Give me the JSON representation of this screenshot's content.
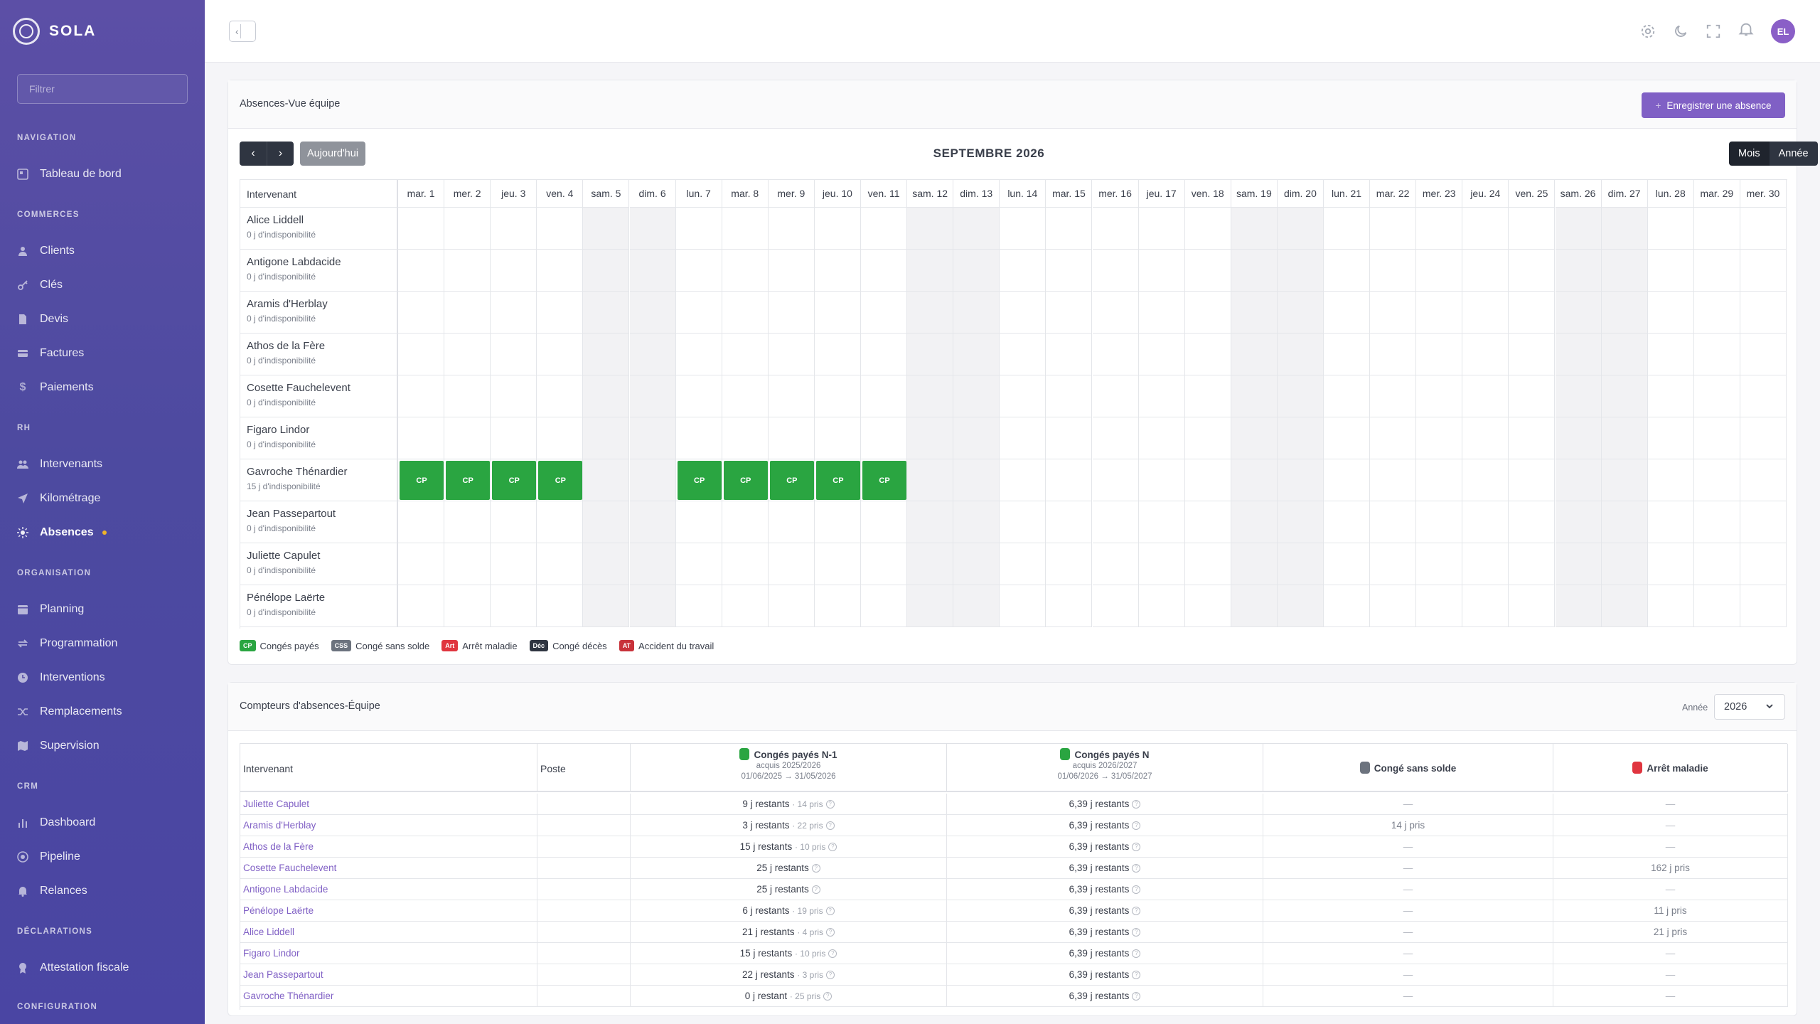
{
  "app": {
    "name": "SOLA"
  },
  "sidebar": {
    "filter_placeholder": "Filtrer",
    "sections": {
      "navigation": "NAVIGATION",
      "commerces": "COMMERCES",
      "rh": "RH",
      "organisation": "ORGANISATION",
      "crm": "CRM",
      "declarations": "DÉCLARATIONS",
      "configuration": "CONFIGURATION"
    },
    "items": {
      "tableau": "Tableau de bord",
      "clients": "Clients",
      "cles": "Clés",
      "devis": "Devis",
      "factures": "Factures",
      "paiements": "Paiements",
      "intervenants": "Intervenants",
      "kilometrage": "Kilométrage",
      "absences": "Absences",
      "planning": "Planning",
      "programmation": "Programmation",
      "interventions": "Interventions",
      "remplacements": "Remplacements",
      "supervision": "Supervision",
      "dashboard": "Dashboard",
      "pipeline": "Pipeline",
      "relances": "Relances",
      "attestation": "Attestation fiscale"
    }
  },
  "topbar": {
    "avatar_initials": "EL"
  },
  "absences": {
    "title": "Absences-Vue équipe",
    "register_label": "Enregistrer une absence",
    "today_label": "Aujourd'hui",
    "month_label": "SEPTEMBRE 2026",
    "view_mois": "Mois",
    "view_annee": "Année",
    "name_header": "Intervenant",
    "days": [
      "mar. 1",
      "mer. 2",
      "jeu. 3",
      "ven. 4",
      "sam. 5",
      "dim. 6",
      "lun. 7",
      "mar. 8",
      "mer. 9",
      "jeu. 10",
      "ven. 11",
      "sam. 12",
      "dim. 13",
      "lun. 14",
      "mar. 15",
      "mer. 16",
      "jeu. 17",
      "ven. 18",
      "sam. 19",
      "dim. 20",
      "lun. 21",
      "mar. 22",
      "mer. 23",
      "jeu. 24",
      "ven. 25",
      "sam. 26",
      "dim. 27",
      "lun. 28",
      "mar. 29",
      "mer. 30"
    ],
    "weekend_index": [
      4,
      5,
      11,
      12,
      18,
      19,
      25,
      26
    ],
    "rows": [
      {
        "name": "Alice Liddell",
        "sub": "0 j d'indisponibilité",
        "cp": []
      },
      {
        "name": "Antigone Labdacide",
        "sub": "0 j d'indisponibilité",
        "cp": []
      },
      {
        "name": "Aramis d'Herblay",
        "sub": "0 j d'indisponibilité",
        "cp": []
      },
      {
        "name": "Athos de la Fère",
        "sub": "0 j d'indisponibilité",
        "cp": []
      },
      {
        "name": "Cosette Fauchelevent",
        "sub": "0 j d'indisponibilité",
        "cp": []
      },
      {
        "name": "Figaro Lindor",
        "sub": "0 j d'indisponibilité",
        "cp": []
      },
      {
        "name": "Gavroche Thénardier",
        "sub": "15 j d'indisponibilité",
        "cp": [
          0,
          1,
          2,
          3,
          6,
          7,
          8,
          9,
          10
        ]
      },
      {
        "name": "Jean Passepartout",
        "sub": "0 j d'indisponibilité",
        "cp": []
      },
      {
        "name": "Juliette Capulet",
        "sub": "0 j d'indisponibilité",
        "cp": []
      },
      {
        "name": "Pénélope Laërte",
        "sub": "0 j d'indisponibilité",
        "cp": []
      }
    ],
    "cp_label": "CP",
    "legend": [
      {
        "tag": "CP",
        "label": "Congés payés",
        "color": "#2aa541"
      },
      {
        "tag": "CSS",
        "label": "Congé sans solde",
        "color": "#6c737e"
      },
      {
        "tag": "Art",
        "label": "Arrêt maladie",
        "color": "#e0353f"
      },
      {
        "tag": "Déc",
        "label": "Congé décès",
        "color": "#2f3541"
      },
      {
        "tag": "AT",
        "label": "Accident du travail",
        "color": "#c8323a"
      }
    ]
  },
  "compteurs": {
    "title": "Compteurs d'absences-Équipe",
    "year_label": "Année",
    "year_value": "2026",
    "headers": {
      "intervenant": "Intervenant",
      "poste": "Poste",
      "cpn1": "Congés payés N-1",
      "cpn1_sub1": "acquis 2025/2026",
      "cpn1_sub2": "01/06/2025 → 31/05/2026",
      "cpn": "Congés payés N",
      "cpn_sub1": "acquis 2026/2027",
      "cpn_sub2": "01/06/2026 → 31/05/2027",
      "css": "Congé sans solde",
      "am": "Arrêt maladie"
    },
    "colors": {
      "cp": "#2aa541",
      "css": "#6c737e",
      "am": "#e0353f"
    },
    "rows": [
      {
        "name": "Juliette Capulet",
        "n1": "9 j restants",
        "n1p": "· 14 pris",
        "n": "6,39 j restants",
        "css": "—",
        "am": "—"
      },
      {
        "name": "Aramis d'Herblay",
        "n1": "3 j restants",
        "n1p": "· 22 pris",
        "n": "6,39 j restants",
        "css": "14 j pris",
        "am": "—"
      },
      {
        "name": "Athos de la Fère",
        "n1": "15 j restants",
        "n1p": "· 10 pris",
        "n": "6,39 j restants",
        "css": "—",
        "am": "—"
      },
      {
        "name": "Cosette Fauchelevent",
        "n1": "25 j restants",
        "n1p": "",
        "n": "6,39 j restants",
        "css": "—",
        "am": "162 j pris"
      },
      {
        "name": "Antigone Labdacide",
        "n1": "25 j restants",
        "n1p": "",
        "n": "6,39 j restants",
        "css": "—",
        "am": "—"
      },
      {
        "name": "Pénélope Laërte",
        "n1": "6 j restants",
        "n1p": "· 19 pris",
        "n": "6,39 j restants",
        "css": "—",
        "am": "11 j pris"
      },
      {
        "name": "Alice Liddell",
        "n1": "21 j restants",
        "n1p": "· 4 pris",
        "n": "6,39 j restants",
        "css": "—",
        "am": "21 j pris"
      },
      {
        "name": "Figaro Lindor",
        "n1": "15 j restants",
        "n1p": "· 10 pris",
        "n": "6,39 j restants",
        "css": "—",
        "am": "—"
      },
      {
        "name": "Jean Passepartout",
        "n1": "22 j restants",
        "n1p": "· 3 pris",
        "n": "6,39 j restants",
        "css": "—",
        "am": "—"
      },
      {
        "name": "Gavroche Thénardier",
        "n1": "0 j restant",
        "n1p": "· 25 pris",
        "n": "6,39 j restants",
        "css": "—",
        "am": "—"
      }
    ]
  }
}
